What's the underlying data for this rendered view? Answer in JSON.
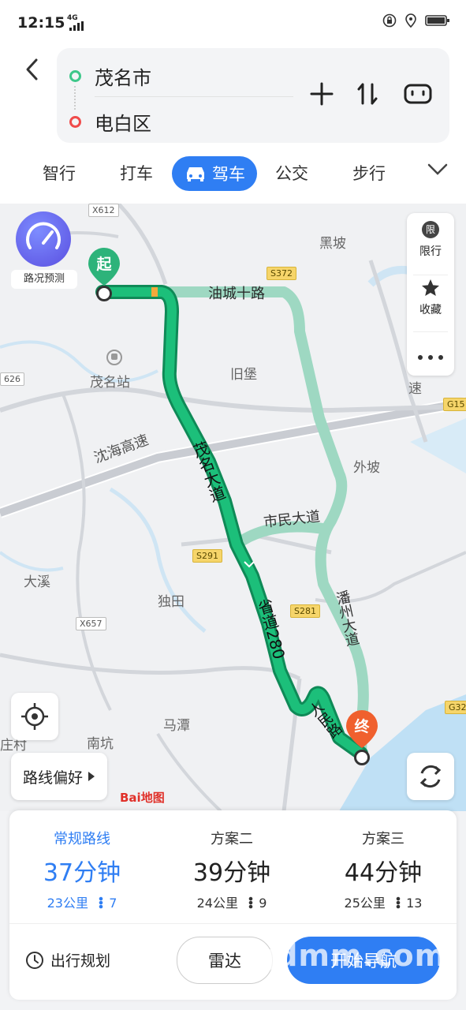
{
  "status": {
    "time": "12:15",
    "network": "4G"
  },
  "route": {
    "from": "茂名市",
    "to": "电白区"
  },
  "tabs": [
    {
      "label": "智行"
    },
    {
      "label": "打车"
    },
    {
      "label": "驾车",
      "active": true
    },
    {
      "label": "公交"
    },
    {
      "label": "步行"
    }
  ],
  "map": {
    "forecast_label": "路况预测",
    "side_panel": {
      "limit_label": "限行",
      "limit_icon_text": "限",
      "favorite_label": "收藏"
    },
    "start_marker": "起",
    "end_marker": "终",
    "route_pref_label": "路线偏好",
    "places": [
      "黑坡",
      "旧堡",
      "茂名站",
      "外坡",
      "大溪",
      "独田",
      "马潭",
      "南坑",
      "庄村",
      "速"
    ],
    "roads": [
      "油城十路",
      "沈海高速",
      "茂名大道",
      "市民大道",
      "省道280",
      "潘州大道",
      "人民路"
    ],
    "road_badges": [
      "X612",
      "S372",
      "626",
      "G15",
      "S291",
      "S281",
      "X657",
      "G32"
    ],
    "logo": "Bai地图"
  },
  "plans": [
    {
      "name": "常规路线",
      "time": "37分钟",
      "distance": "23公里",
      "lights": "7",
      "selected": true
    },
    {
      "name": "方案二",
      "time": "39分钟",
      "distance": "24公里",
      "lights": "9"
    },
    {
      "name": "方案三",
      "time": "44分钟",
      "distance": "25公里",
      "lights": "13"
    }
  ],
  "footer": {
    "schedule_label": "出行规划",
    "radar_label": "雷达",
    "start_label": "开始导航",
    "watermark": "gdmm.com"
  },
  "colors": {
    "accent": "#2f7ef3",
    "route_main": "#17a86a",
    "route_alt": "#8ccfb8",
    "start": "#2db37a",
    "end": "#f0602e"
  }
}
